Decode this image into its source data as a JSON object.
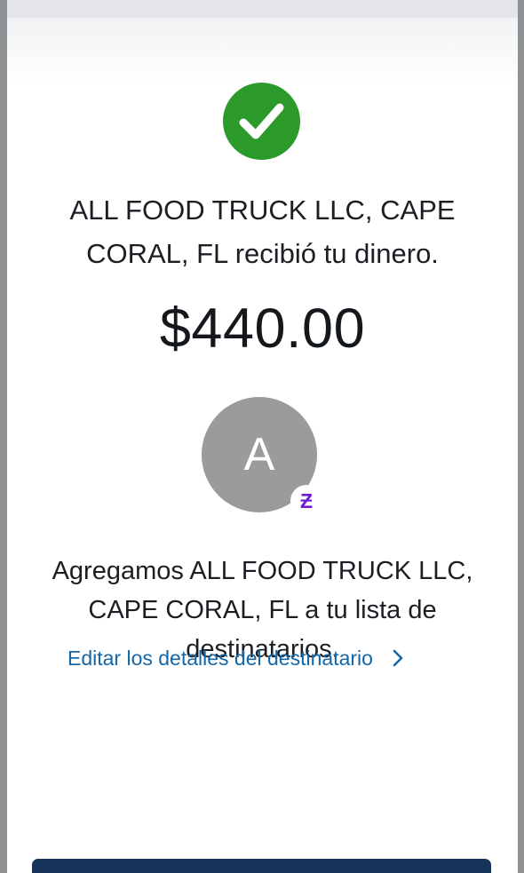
{
  "status": {
    "icon": "check-circle-icon",
    "color": "#2b9a2b"
  },
  "confirmation": {
    "message": "ALL FOOD TRUCK LLC, CAPE CORAL, FL recibió tu dinero.",
    "amount": "$440.00"
  },
  "recipient": {
    "avatar_initial": "A",
    "avatar_color": "#9b9b9b",
    "badge_icon": "zelle-icon",
    "badge_glyph": "Ƶ",
    "badge_color": "#6d1ed4"
  },
  "notice": {
    "added_text": "Agregamos ALL FOOD TRUCK LLC, CAPE CORAL, FL a tu lista de destinatarios.",
    "edit_link_label": "Editar los detalles del destinatario",
    "link_color": "#1367a8"
  }
}
